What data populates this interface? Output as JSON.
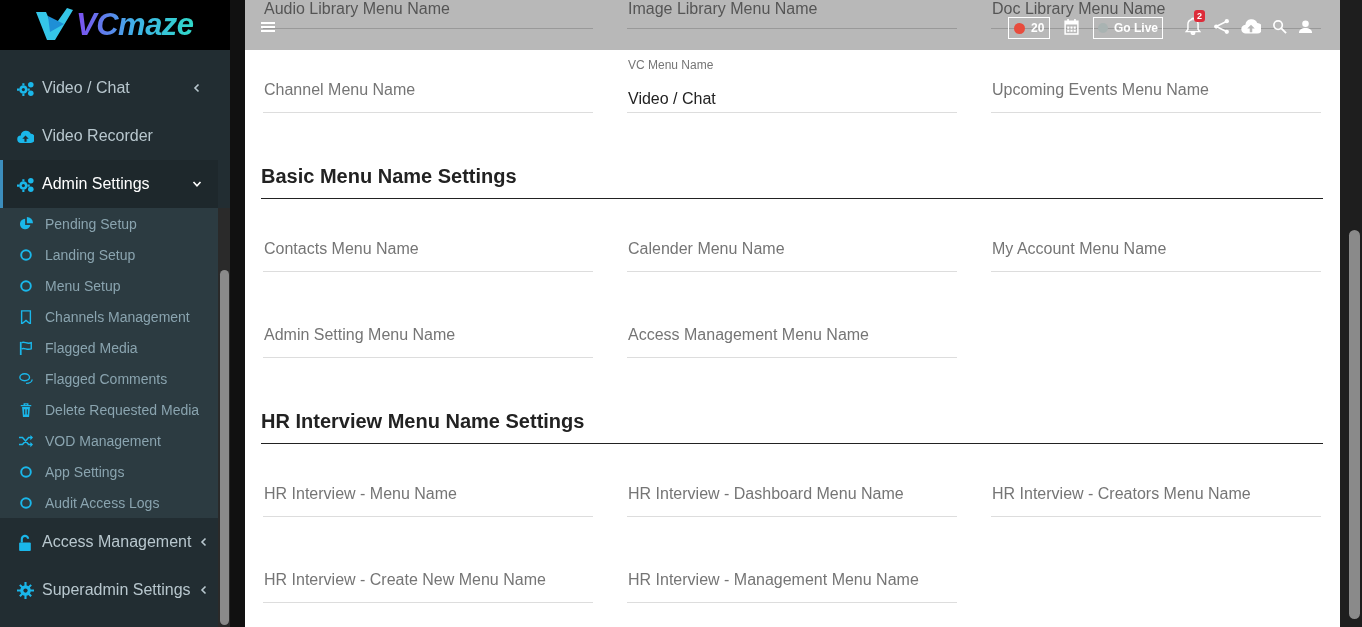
{
  "logo": {
    "text": "VCmaze"
  },
  "header": {
    "record_count": "20",
    "go_live": "Go Live",
    "notification_count": "2"
  },
  "sidebar": {
    "items": [
      {
        "label": "Video / Chat",
        "expanded": false,
        "selected": false
      },
      {
        "label": "Video Recorder",
        "selected": false
      },
      {
        "label": "Admin Settings",
        "expanded": true,
        "selected": true,
        "children": [
          {
            "label": "Pending Setup",
            "selected": false
          },
          {
            "label": "Landing Setup",
            "selected": false
          },
          {
            "label": "Menu Setup",
            "selected": false
          },
          {
            "label": "Channels Management",
            "selected": false
          },
          {
            "label": "Flagged Media",
            "selected": false
          },
          {
            "label": "Flagged Comments",
            "selected": false
          },
          {
            "label": "Delete Requested Media",
            "selected": false
          },
          {
            "label": "VOD Management",
            "selected": false
          },
          {
            "label": "App Settings",
            "selected": false
          },
          {
            "label": "Audit Access Logs",
            "selected": false
          }
        ]
      },
      {
        "label": "Access Management",
        "expanded": false,
        "selected": false
      },
      {
        "label": "Superadmin Settings",
        "expanded": false,
        "selected": false
      }
    ]
  },
  "sections": [
    {
      "fields": [
        {
          "placeholder": "Audio Library Menu Name"
        },
        {
          "placeholder": "Image Library Menu Name"
        },
        {
          "placeholder": "Doc Library Menu Name"
        },
        {
          "placeholder": "Channel Menu Name"
        },
        {
          "label": "VC Menu Name",
          "value": "Video / Chat"
        },
        {
          "placeholder": "Upcoming Events Menu Name"
        }
      ]
    },
    {
      "title": "Basic Menu Name Settings",
      "fields": [
        {
          "placeholder": "Contacts Menu Name"
        },
        {
          "placeholder": "Calender Menu Name"
        },
        {
          "placeholder": "My Account Menu Name"
        },
        {
          "placeholder": "Admin Setting Menu Name"
        },
        {
          "placeholder": "Access Management Menu Name"
        }
      ]
    },
    {
      "title": "HR Interview Menu Name Settings",
      "fields": [
        {
          "placeholder": "HR Interview - Menu Name"
        },
        {
          "placeholder": "HR Interview - Dashboard Menu Name"
        },
        {
          "placeholder": "HR Interview - Creators Menu Name"
        },
        {
          "placeholder": "HR Interview - Create New Menu Name"
        },
        {
          "placeholder": "HR Interview - Management Menu Name"
        }
      ]
    }
  ]
}
